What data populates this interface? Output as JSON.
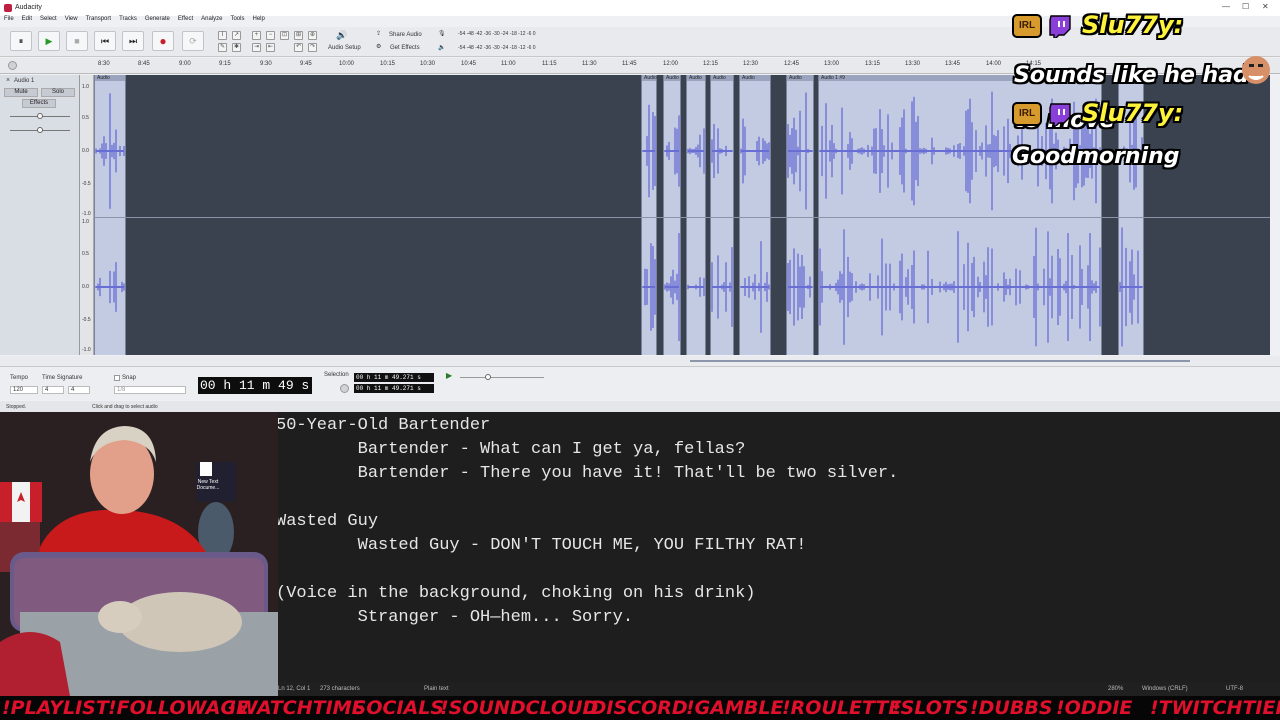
{
  "window": {
    "title": "Audacity",
    "controls": [
      "—",
      "☐",
      "✕"
    ]
  },
  "menu": [
    "File",
    "Edit",
    "Select",
    "View",
    "Transport",
    "Tracks",
    "Generate",
    "Effect",
    "Analyze",
    "Tools",
    "Help"
  ],
  "toolbar": {
    "pause": "⏸",
    "play": "▶",
    "stop": "■",
    "skip_start": "⏮",
    "skip_end": "⏭",
    "record": "●",
    "loop": "⟳",
    "audio_setup": "Audio Setup",
    "share_audio": "Share Audio",
    "get_effects": "Get Effects",
    "meter_ticks": "-54 -48 -42 -36 -30 -24 -18 -12 -6 0"
  },
  "ruler": {
    "ticks": [
      "8:30",
      "8:45",
      "9:00",
      "9:15",
      "9:30",
      "9:45",
      "10:00",
      "10:15",
      "10:30",
      "10:45",
      "11:00",
      "11:15",
      "11:30",
      "11:45",
      "12:00",
      "12:15",
      "12:30",
      "12:45",
      "13:00",
      "13:15",
      "13:30",
      "13:45",
      "14:00",
      "14:15"
    ]
  },
  "track": {
    "name": "Audio 1",
    "mute": "Mute",
    "solo": "Solo",
    "effects": "Effects",
    "clip_names": [
      "Audio",
      "Audio",
      "Audio",
      "Audio",
      "Audio",
      "Audio",
      "Audio",
      "Audio",
      "Audio 1 #9"
    ],
    "scale": [
      "1.0",
      "0.5",
      "0.0",
      "-0.5",
      "-1.0",
      "1.0",
      "0.5",
      "0.0",
      "-0.5",
      "-1.0"
    ]
  },
  "bottom": {
    "tempo_label": "Tempo",
    "tempo_value": "120",
    "time_sig_label": "Time Signature",
    "time_sig_top": "4",
    "time_sig_bottom": "4",
    "snap_label": "Snap",
    "snap_value": "1/8",
    "time": "00 h 11 m 49 s",
    "selection_label": "Selection",
    "sel_start": "00 h 11 m 49.271 s",
    "sel_end": "00 h 11 m 49.271 s"
  },
  "status": {
    "left": "Stopped.",
    "middle": "Click and drag to select audio"
  },
  "editor": {
    "lines": [
      "50-Year-Old Bartender",
      "        Bartender - What can I get ya, fellas?",
      "        Bartender - There you have it! That'll be two silver.",
      "",
      "Wasted Guy",
      "        Wasted Guy - DON'T TOUCH ME, YOU FILTHY RAT!",
      "",
      "(Voice in the background, choking on his drink)",
      "        Stranger - OH—hem... Sorry."
    ],
    "status_pos": "Ln 12, Col 1",
    "status_chars": "273 characters",
    "status_type": "Plain text",
    "status_zoom": "280%",
    "status_eol": "Windows (CRLF)",
    "status_enc": "UTF-8"
  },
  "desktop_icon": {
    "label": "New Text Docume..."
  },
  "chat": [
    {
      "badge": "IRL",
      "user": "Slu77y:",
      "msg": "Sounds like he had to move"
    },
    {
      "badge": "IRL",
      "user": "Slu77y:",
      "msg": "Goodmorning"
    }
  ],
  "ticker": [
    "!PLAYLIST",
    "!FOLLOWAGE",
    "!WATCHTIME",
    "!SOCIALS",
    "!SOUNDCLOUD",
    "!DISCORD",
    "!GAMBLE",
    "!ROULETTE",
    "!SLOTS",
    "!DUBBS",
    "!ODDIE",
    "!TWITCHTIER"
  ],
  "colors": {
    "wave": "#4b4fd0",
    "clip_bg": "#c3cbe2",
    "track_bg": "#39424e",
    "ticker": "#e0102c",
    "chat_user": "#fff23a"
  }
}
